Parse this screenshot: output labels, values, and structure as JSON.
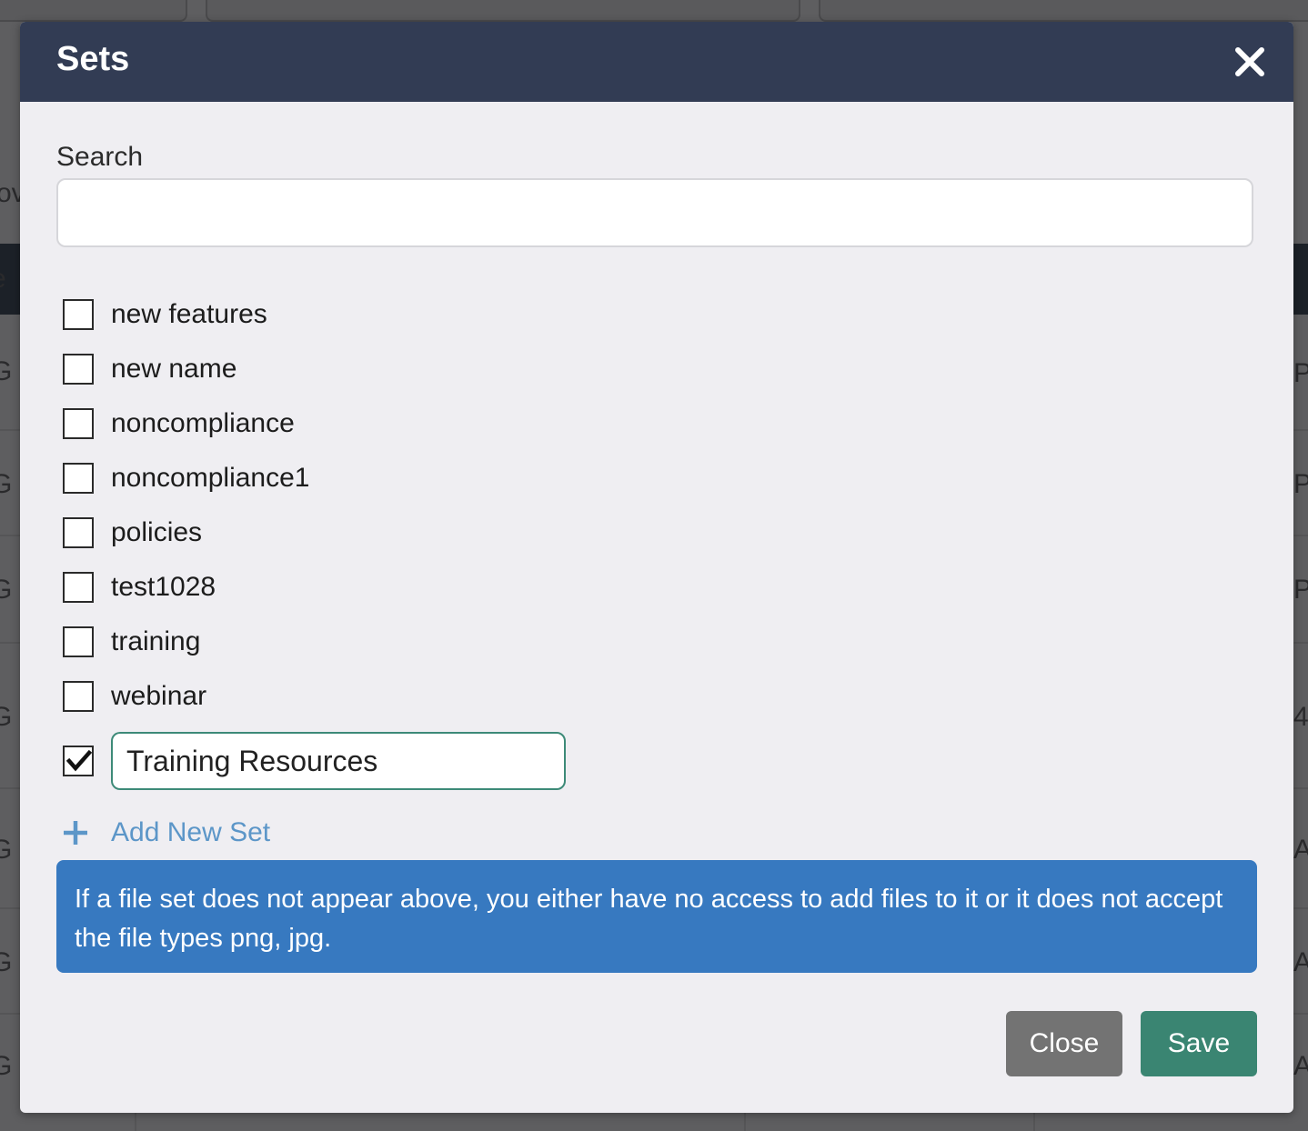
{
  "modal": {
    "title": "Sets",
    "search": {
      "label": "Search",
      "value": "",
      "placeholder": ""
    },
    "sets": [
      {
        "label": "new features",
        "checked": false
      },
      {
        "label": "new name",
        "checked": false
      },
      {
        "label": "noncompliance",
        "checked": false
      },
      {
        "label": "noncompliance1",
        "checked": false
      },
      {
        "label": "policies",
        "checked": false
      },
      {
        "label": "test1028",
        "checked": false
      },
      {
        "label": "training",
        "checked": false
      },
      {
        "label": "webinar",
        "checked": false
      }
    ],
    "new_set": {
      "value": "Training Resources",
      "checked": true
    },
    "add_new_set_label": "Add New Set",
    "info_text": "If a file set does not appear above, you either have no access to add files to it or it does not accept the file types png, jpg.",
    "buttons": {
      "close_label": "Close",
      "save_label": "Save"
    }
  },
  "background": {
    "left_glyphs": [
      "ov",
      "e",
      "G",
      "G",
      "G",
      "G",
      "G",
      "G",
      "G"
    ],
    "right_glyphs": [
      "P",
      "P",
      "P",
      "4",
      "A",
      "A",
      "A"
    ]
  },
  "colors": {
    "header_bg": "#323c54",
    "modal_bg": "#efeef2",
    "info_bg": "#3779c0",
    "link": "#5c96c8",
    "save_bg": "#3a8572",
    "close_bg": "#737373",
    "new_set_border": "#3d8a78"
  }
}
